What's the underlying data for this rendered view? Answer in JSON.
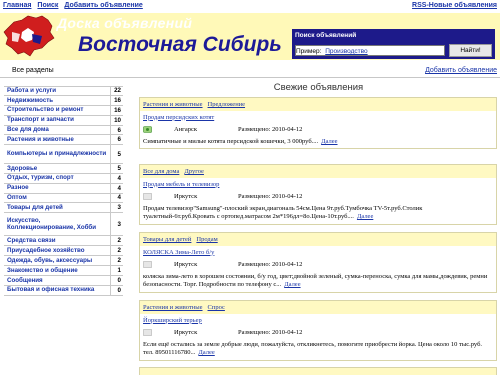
{
  "top_nav": {
    "home": "Главная",
    "search": "Поиск",
    "add": "Добавить объявление"
  },
  "rss": "RSS-Новые объявления",
  "header": {
    "subtitle": "Доска объявлений",
    "title": "Восточная Сибирь"
  },
  "search": {
    "label": "Поиск объявлений",
    "value": "",
    "placeholder": "",
    "button": "Найти!",
    "example_label": "Пример:",
    "example_link": "Производство"
  },
  "all_sections": "Все разделы",
  "add_listing": "Добавить объявление",
  "main_title": "Свежие объявления",
  "categories": [
    {
      "label": "Работа и услуги",
      "count": "22"
    },
    {
      "label": "Недвижимость",
      "count": "16"
    },
    {
      "label": "Строительство и ремонт",
      "count": "16"
    },
    {
      "label": "Транспорт и запчасти",
      "count": "10"
    },
    {
      "label": "Все для дома",
      "count": "6"
    },
    {
      "label": "Растения и животные",
      "count": "6"
    },
    {
      "label": "Компьютеры и принадлежности",
      "count": "5"
    },
    {
      "label": "Здоровье",
      "count": "5"
    },
    {
      "label": "Отдых, туризм, спорт",
      "count": "4"
    },
    {
      "label": "Разное",
      "count": "4"
    },
    {
      "label": "Оптом",
      "count": "4"
    },
    {
      "label": "Товары для детей",
      "count": "3"
    },
    {
      "label": "Искусство, Коллекционирование, Хобби",
      "count": "3"
    },
    {
      "label": "Средства связи",
      "count": "2"
    },
    {
      "label": "Приусадебное хозяйство",
      "count": "2"
    },
    {
      "label": "Одежда, обувь, аксессуары",
      "count": "2"
    },
    {
      "label": "Знакомство и общение",
      "count": "1"
    },
    {
      "label": "Сообщения",
      "count": "0"
    },
    {
      "label": "Бытовая и офисная техника",
      "count": "0"
    }
  ],
  "listings": [
    {
      "category": "Растения и животные",
      "type": "Предложение",
      "title": "Продам персидских котят",
      "city": "Ангарск",
      "posted": "Размещено: 2010-04-12",
      "desc": "Симпатичные и милые котята персидской кошечки, 3 000руб....",
      "more": "Далее"
    },
    {
      "category": "Все для дома",
      "type": "Другое",
      "title": "Продам мебель и телевизор",
      "city": "Иркутск",
      "posted": "Размещено: 2010-04-12",
      "desc": "Продам телевизор\"Samsung\"-плоский экран,диагональ 54см.Цена 9т.руб.Тумбочка ТV-5т.руб.Столик туалетный-6т.руб.Кровать с ортопед.матрасом 2м*196дл=8о.Цена-10т.руб....",
      "more": "Далее"
    },
    {
      "category": "Товары для детей",
      "type": "Продам",
      "title": "КОЛЯСКА Зима-Лето б/у",
      "city": "Иркутск",
      "posted": "Размещено: 2010-04-12",
      "desc": "коляска зима-лето в хорошем состоянии, б/у год, цвет;двойной зеленый, сумка-переноска, сумка для мамы,дождевик, ремни безопасности. Торг. Подробности по телефону с...",
      "more": "Далее"
    },
    {
      "category": "Растения и животные",
      "type": "Спрос",
      "title": "Йоркширский терьер",
      "city": "Иркутск",
      "posted": "Размещено: 2010-04-12",
      "desc": "Если ещё остались за земле добрые люди, пожалуйста, откликнетесь, помогите приобрести йорка. Цена около 10 тыс.руб. тел. 89501116780...",
      "more": "Далее"
    }
  ],
  "colors": {
    "header_bg": "#fff9b8",
    "search_bg": "#1d1a8a",
    "title": "#1d1a98",
    "link": "#1a35a8",
    "listing_head_bg": "#fff9c2",
    "map_red": "#d01e1e"
  }
}
